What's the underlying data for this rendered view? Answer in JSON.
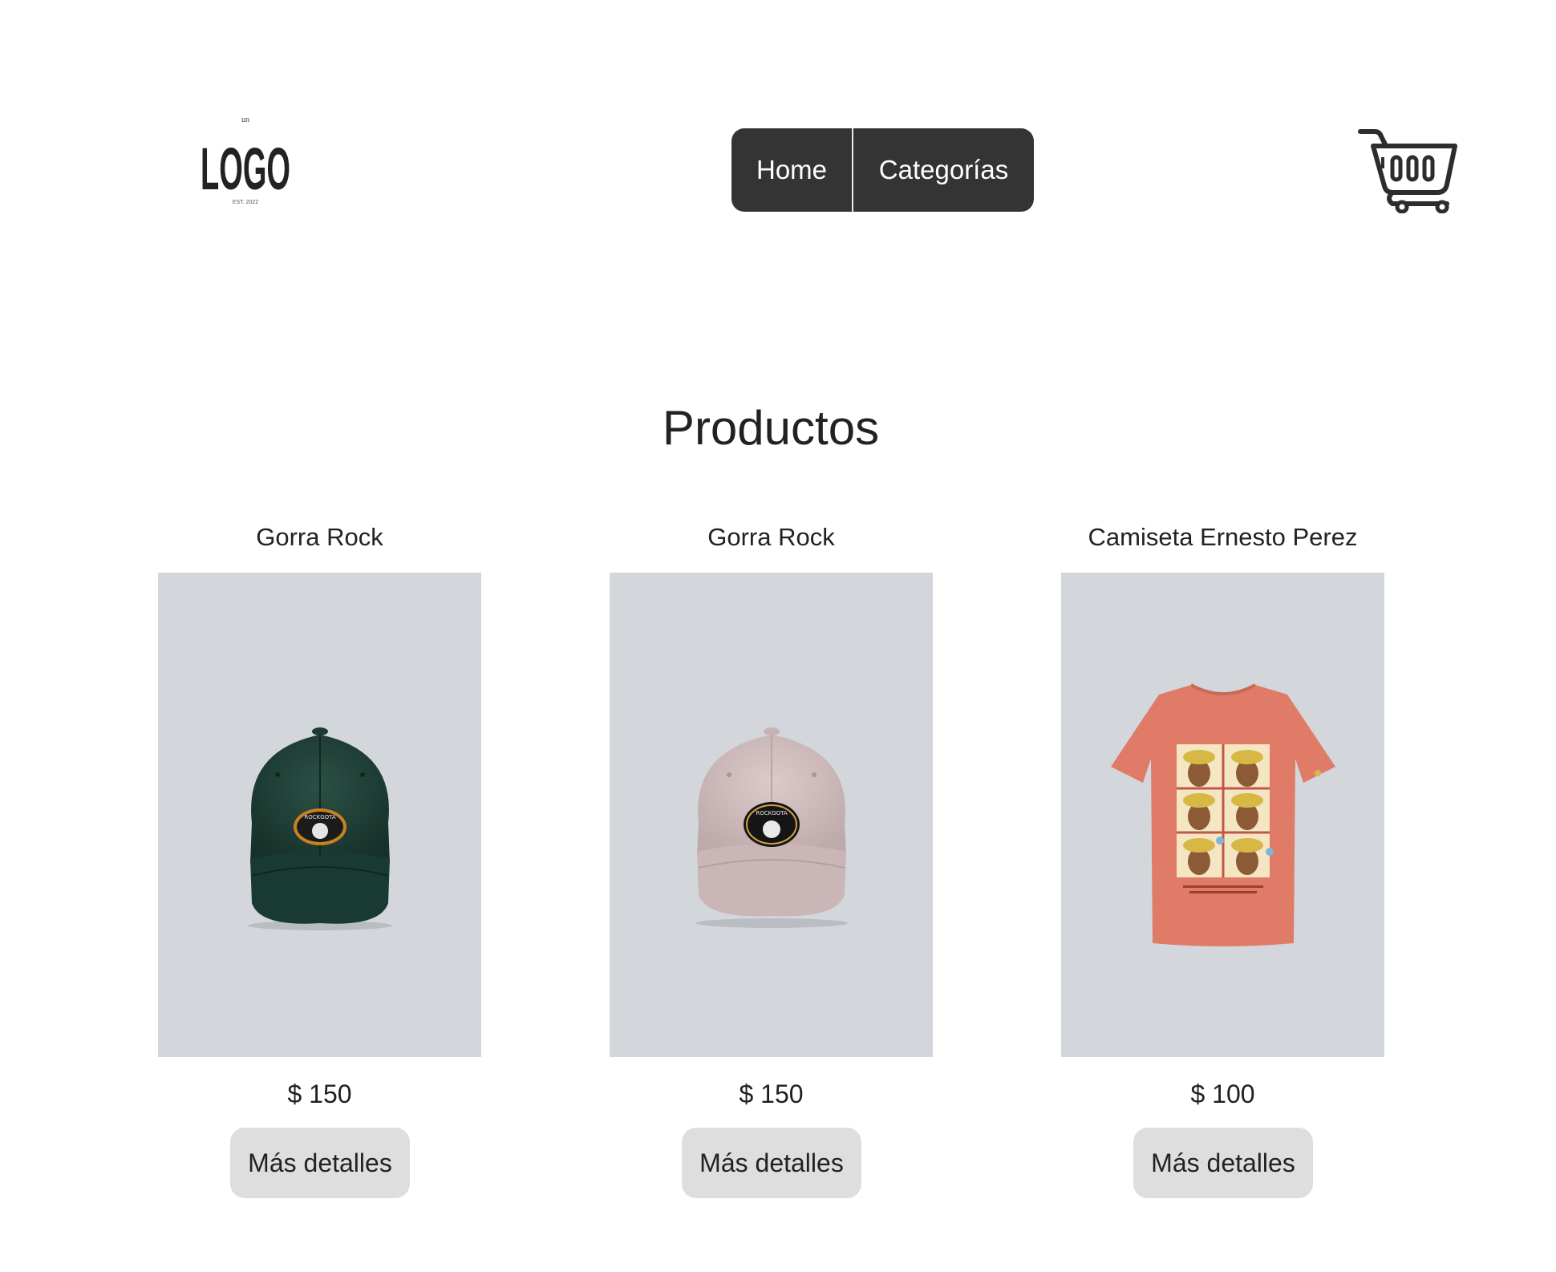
{
  "header": {
    "logo": {
      "top_text": "un",
      "main_text": "LOGO",
      "bottom_text": "EST. 2022"
    },
    "nav": {
      "items": [
        {
          "label": "Home"
        },
        {
          "label": "Categorías"
        }
      ]
    },
    "cart_icon": "shopping-cart-icon"
  },
  "main": {
    "title": "Productos",
    "products": [
      {
        "name": "Gorra Rock",
        "price": "$ 150",
        "button_label": "Más detalles",
        "image": "green-cap",
        "color": "#1d3b34"
      },
      {
        "name": "Gorra Rock",
        "price": "$ 150",
        "button_label": "Más detalles",
        "image": "pink-cap",
        "color": "#cdb8b9"
      },
      {
        "name": "Camiseta Ernesto Perez",
        "price": "$ 100",
        "button_label": "Más detalles",
        "image": "coral-tshirt",
        "color": "#df7b66"
      }
    ]
  },
  "colors": {
    "nav_background": "#343434",
    "image_background": "#d3d6db",
    "button_background": "#dedede"
  }
}
